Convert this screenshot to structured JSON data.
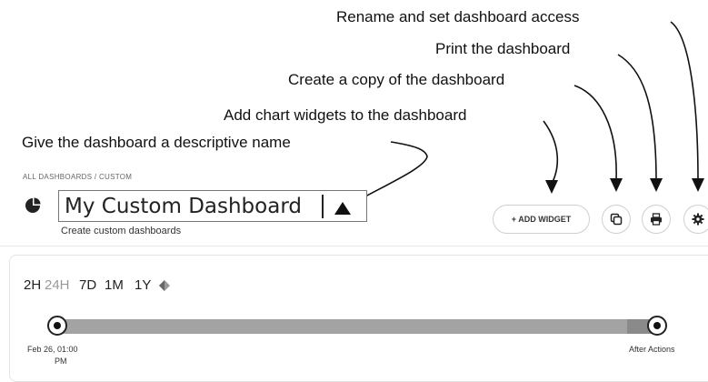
{
  "annotations": {
    "rename": "Rename and set dashboard access",
    "print": "Print the dashboard",
    "copy": "Create a copy of the dashboard",
    "add_widgets": "Add chart widgets to the dashboard",
    "name": "Give the dashboard a descriptive name"
  },
  "header": {
    "breadcrumb": "ALL DASHBOARDS / CUSTOM",
    "title_value": "My Custom Dashboard",
    "subtitle": "Create custom dashboards",
    "add_widget_label": "+ ADD WIDGET"
  },
  "icons": {
    "dashboard": "pie-chart-icon",
    "copy": "copy-icon",
    "print": "printer-icon",
    "settings": "gear-icon"
  },
  "time_range": {
    "options": [
      "2H",
      "24H",
      "7D",
      "1M",
      "1Y"
    ],
    "selected": "24H",
    "start_label_line1": "Feb 26, 01:00",
    "start_label_line2": "PM",
    "end_label": "After Actions"
  }
}
